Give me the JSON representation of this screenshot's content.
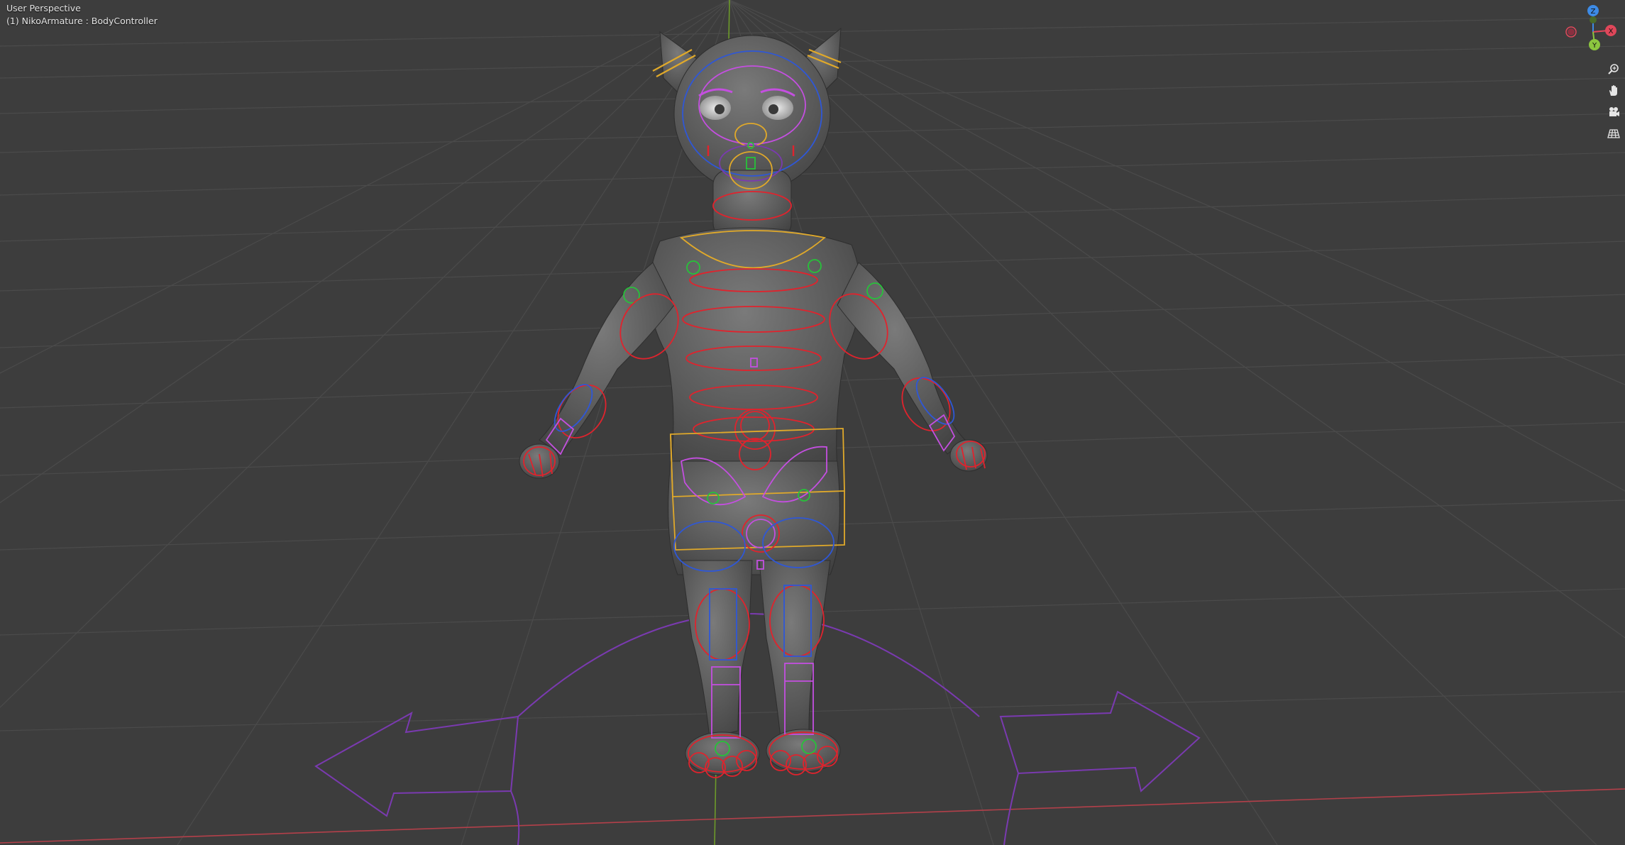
{
  "viewport": {
    "perspective_label": "User Perspective",
    "active_object_label": "(1) NikoArmature : BodyController"
  },
  "gizmo": {
    "z_label": "Z",
    "y_label": "Y",
    "x_label": "X",
    "colors": {
      "x": "#e0475a",
      "y": "#8cc63f",
      "z": "#3d8be6"
    }
  },
  "nav_buttons": [
    {
      "name": "zoom-icon"
    },
    {
      "name": "pan-hand-icon"
    },
    {
      "name": "camera-view-icon"
    },
    {
      "name": "ortho-grid-icon"
    }
  ],
  "colors": {
    "background": "#3d3d3d",
    "grid": "#4a4a4a",
    "x_axis": "#b3404a",
    "y_axis": "#6d9a2a",
    "mesh": "#5b5b5b",
    "bone_red": "#e0232d",
    "bone_blue": "#2f57d6",
    "bone_magenta": "#c44fe0",
    "bone_yellow": "#e0a92a",
    "bone_green": "#27c23a",
    "bone_purple": "#7a3ab0"
  }
}
